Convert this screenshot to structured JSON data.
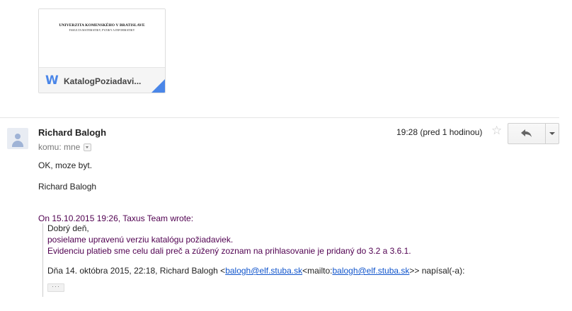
{
  "attachment": {
    "preview_line1": "UNIVERZITA KOMENSKÉHO V BRATISLAVE",
    "preview_line2": "FAKULTA MATEMATIKY, FYZIKY A INFORMATIKY",
    "file_icon_glyph": "W",
    "file_icon": "word-document-icon",
    "file_name": "KatalogPoziadavi...",
    "accent_color": "#4a86e8"
  },
  "message": {
    "sender": "Richard Balogh",
    "recipient_label": "komu: mne",
    "timestamp": "19:28 (pred 1 hodinou)",
    "star_glyph": "☆",
    "body": [
      "OK, moze byt.",
      "Richard Balogh"
    ],
    "quote": {
      "header": "On 15.10.2015 19:26, Taxus Team wrote:",
      "line1": "Dobrý deň,",
      "line2": "posielame upravenú verziu katalógu požiadaviek.",
      "line3": "Evidenciu platieb sme celu dali preč a zúžený zoznam na prihlasovanie je pridaný do 3.2 a 3.6.1.",
      "attribution_prefix": "Dňa 14. októbra 2015, 22:18, Richard Balogh <",
      "attribution_link1": "balogh@elf.stuba.sk",
      "attribution_middle": "<mailto:",
      "attribution_link2": "balogh@elf.stuba.sk",
      "attribution_suffix": ">> napísal(-a):",
      "more_glyph": "···"
    }
  }
}
